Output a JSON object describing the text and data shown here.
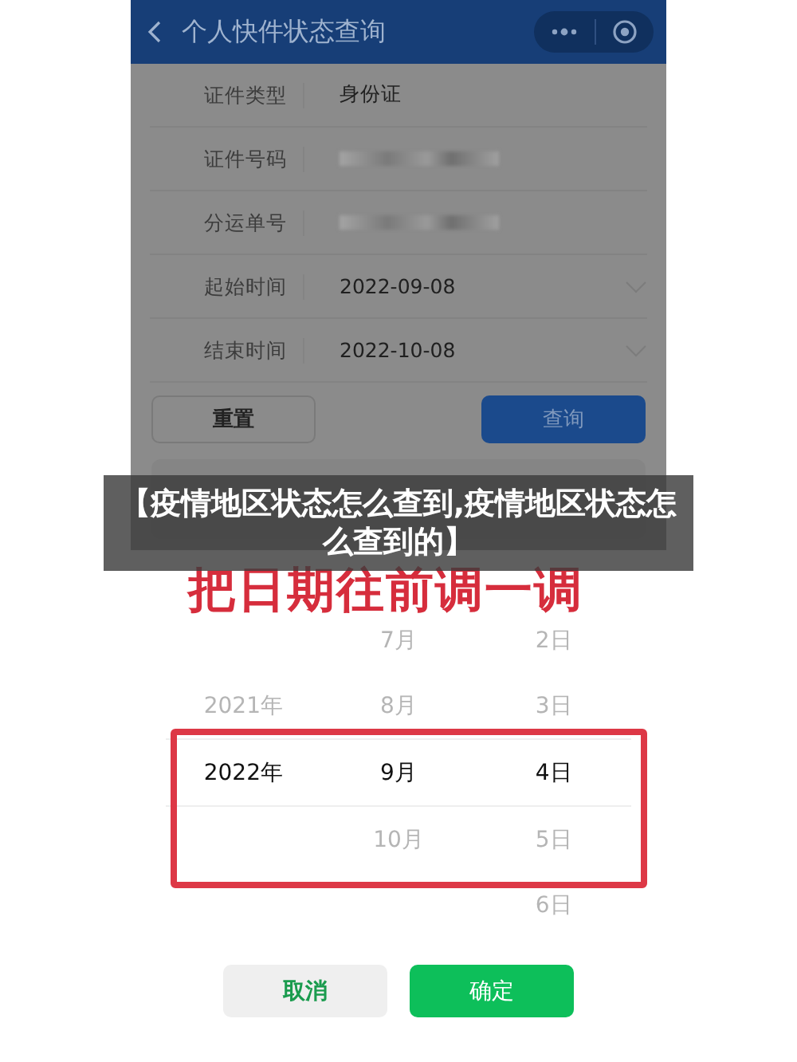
{
  "nav": {
    "title": "个人快件状态查询"
  },
  "form": {
    "fields": [
      {
        "kind": "text",
        "label": "证件类型",
        "value": "身份证"
      },
      {
        "kind": "blurred",
        "label": "证件号码"
      },
      {
        "kind": "blurred",
        "label": "分运单号"
      },
      {
        "kind": "date",
        "label": "起始时间",
        "value": "2022-09-08"
      },
      {
        "kind": "date",
        "label": "结束时间",
        "value": "2022-10-08"
      }
    ],
    "buttons": [
      {
        "kind": "secondary",
        "label": "重置"
      },
      {
        "kind": "primary",
        "label": "查询"
      }
    ]
  },
  "annotation": {
    "text": "把日期往前调一调"
  },
  "picker": {
    "rows": [
      {
        "month": "7月",
        "day": "2日",
        "selected": false
      },
      {
        "year": "2021年",
        "month": "8月",
        "day": "3日",
        "selected": false
      },
      {
        "year": "2022年",
        "month": "9月",
        "day": "4日",
        "selected": true
      },
      {
        "month": "10月",
        "day": "5日",
        "selected": false
      },
      {
        "day": "6日",
        "selected": false
      }
    ],
    "buttons": [
      {
        "kind": "secondary",
        "label": "取消"
      },
      {
        "kind": "primary",
        "label": "确定"
      }
    ]
  },
  "banner": {
    "title": "【疫情地区状态怎么查到,疫情地区状态怎么查到的】"
  }
}
